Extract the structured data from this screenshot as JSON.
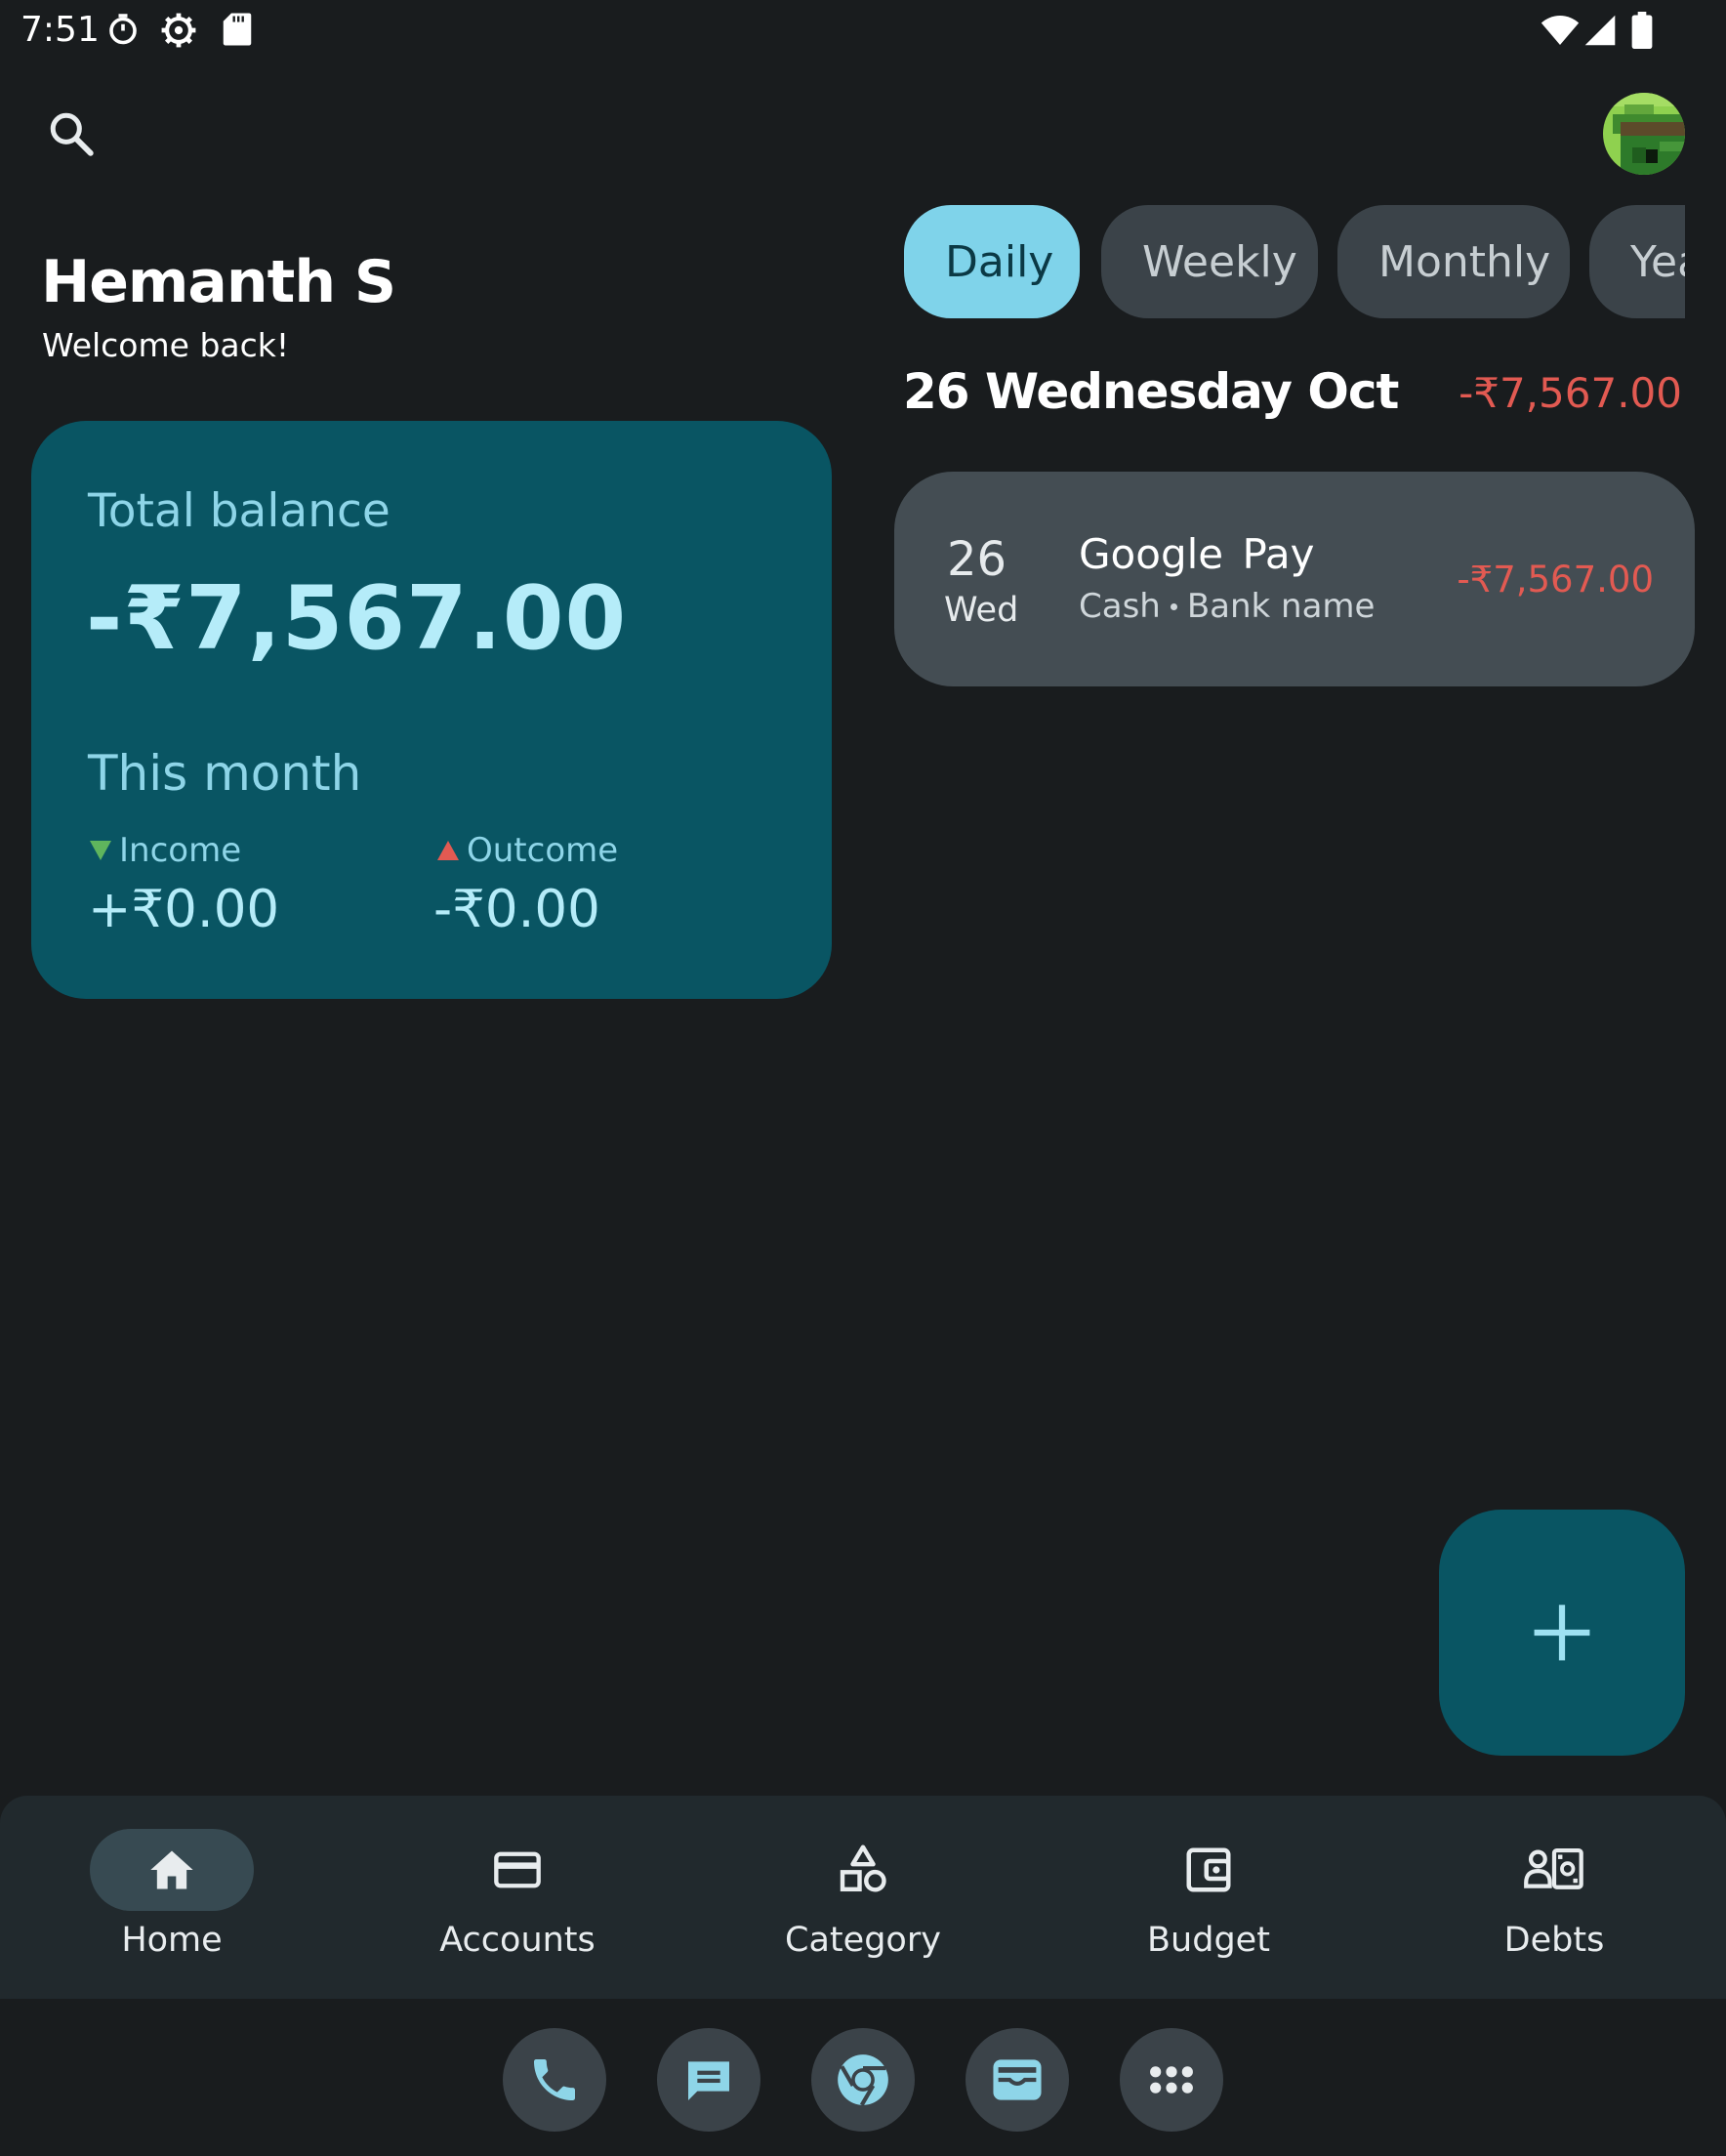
{
  "status_bar": {
    "time": "7:51",
    "left_icons": [
      "timer-icon",
      "settings-gear-icon",
      "sd-card-icon"
    ],
    "right_icons": [
      "wifi-icon",
      "cell-signal-icon",
      "battery-icon"
    ]
  },
  "header": {
    "search_icon": "search-icon",
    "avatar_icon": "pixel-art-avatar"
  },
  "user": {
    "name": "Hemanth S",
    "welcome": "Welcome back!"
  },
  "balance_card": {
    "title": "Total balance",
    "amount": "-₹7,567.00",
    "month_label": "This month",
    "income_label": "Income",
    "income_value": "+₹0.00",
    "outcome_label": "Outcome",
    "outcome_value": "-₹0.00"
  },
  "period_tabs": [
    {
      "label": "Daily",
      "active": true
    },
    {
      "label": "Weekly",
      "active": false
    },
    {
      "label": "Monthly",
      "active": false
    },
    {
      "label": "Yearly",
      "active": false
    }
  ],
  "day_group": {
    "date": "26 Wednesday Oct",
    "total": "-₹7,567.00",
    "transactions": [
      {
        "day_num": "26",
        "day_name": "Wed",
        "title": "Google Pay",
        "account": "Cash",
        "bank": "Bank name",
        "amount": "-₹7,567.00"
      }
    ]
  },
  "fab": {
    "icon": "plus-icon"
  },
  "bottom_nav": [
    {
      "label": "Home",
      "icon": "home-icon",
      "active": true
    },
    {
      "label": "Accounts",
      "icon": "credit-card-icon",
      "active": false
    },
    {
      "label": "Category",
      "icon": "category-shapes-icon",
      "active": false
    },
    {
      "label": "Budget",
      "icon": "wallet-icon",
      "active": false
    },
    {
      "label": "Debts",
      "icon": "debts-icon",
      "active": false
    }
  ],
  "dock": [
    {
      "icon": "phone-icon"
    },
    {
      "icon": "messages-icon"
    },
    {
      "icon": "chrome-icon"
    },
    {
      "icon": "wallet-app-icon"
    },
    {
      "icon": "app-drawer-icon"
    }
  ],
  "colors": {
    "background": "#191c1e",
    "card": "#095563",
    "accent": "#7fd3ea",
    "negative": "#e25a52",
    "positive": "#5fb55d",
    "surface": "#444d53"
  }
}
